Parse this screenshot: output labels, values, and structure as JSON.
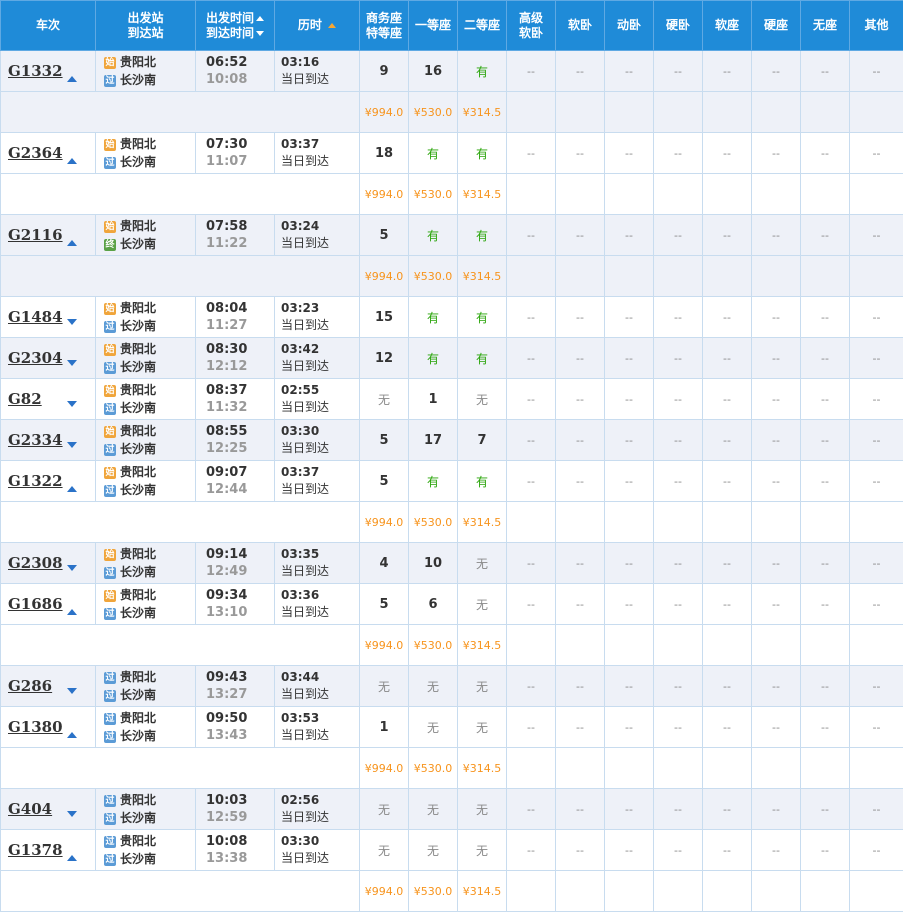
{
  "headers": {
    "train": "车次",
    "dep_station": "出发站",
    "arr_station": "到达站",
    "dep_time": "出发时间",
    "arr_time": "到达时间",
    "duration": "历时",
    "business_1": "商务座",
    "business_2": "特等座",
    "first": "一等座",
    "second": "二等座",
    "hs_1": "高级",
    "hs_2": "软卧",
    "soft_sleeper": "软卧",
    "dyn_sleeper": "动卧",
    "hard_sleeper": "硬卧",
    "soft_seat": "软座",
    "hard_seat": "硬座",
    "no_seat": "无座",
    "other": "其他"
  },
  "labels": {
    "dash": "--"
  },
  "trains": [
    {
      "no": "G1332",
      "toggle": "up",
      "dep_tag": "始",
      "arr_tag": "过",
      "dep_station": "贵阳北",
      "arr_station": "长沙南",
      "dep_time": "06:52",
      "arr_time": "10:08",
      "duration": "03:16",
      "day": "当日到达",
      "business": "9",
      "first": "16",
      "second": "有",
      "price": {
        "business": "¥994.0",
        "first": "¥530.0",
        "second": "¥314.5"
      }
    },
    {
      "no": "G2364",
      "toggle": "up",
      "dep_tag": "始",
      "arr_tag": "过",
      "dep_station": "贵阳北",
      "arr_station": "长沙南",
      "dep_time": "07:30",
      "arr_time": "11:07",
      "duration": "03:37",
      "day": "当日到达",
      "business": "18",
      "first": "有",
      "second": "有",
      "price": {
        "business": "¥994.0",
        "first": "¥530.0",
        "second": "¥314.5"
      }
    },
    {
      "no": "G2116",
      "toggle": "up",
      "dep_tag": "始",
      "arr_tag": "终",
      "dep_station": "贵阳北",
      "arr_station": "长沙南",
      "dep_time": "07:58",
      "arr_time": "11:22",
      "duration": "03:24",
      "day": "当日到达",
      "business": "5",
      "first": "有",
      "second": "有",
      "price": {
        "business": "¥994.0",
        "first": "¥530.0",
        "second": "¥314.5"
      }
    },
    {
      "no": "G1484",
      "toggle": "down",
      "dep_tag": "始",
      "arr_tag": "过",
      "dep_station": "贵阳北",
      "arr_station": "长沙南",
      "dep_time": "08:04",
      "arr_time": "11:27",
      "duration": "03:23",
      "day": "当日到达",
      "business": "15",
      "first": "有",
      "second": "有"
    },
    {
      "no": "G2304",
      "toggle": "down",
      "dep_tag": "始",
      "arr_tag": "过",
      "dep_station": "贵阳北",
      "arr_station": "长沙南",
      "dep_time": "08:30",
      "arr_time": "12:12",
      "duration": "03:42",
      "day": "当日到达",
      "business": "12",
      "first": "有",
      "second": "有"
    },
    {
      "no": "G82",
      "toggle": "down",
      "dep_tag": "始",
      "arr_tag": "过",
      "dep_station": "贵阳北",
      "arr_station": "长沙南",
      "dep_time": "08:37",
      "arr_time": "11:32",
      "duration": "02:55",
      "day": "当日到达",
      "business": "无",
      "first": "1",
      "second": "无"
    },
    {
      "no": "G2334",
      "toggle": "down",
      "dep_tag": "始",
      "arr_tag": "过",
      "dep_station": "贵阳北",
      "arr_station": "长沙南",
      "dep_time": "08:55",
      "arr_time": "12:25",
      "duration": "03:30",
      "day": "当日到达",
      "business": "5",
      "first": "17",
      "second": "7"
    },
    {
      "no": "G1322",
      "toggle": "up",
      "dep_tag": "始",
      "arr_tag": "过",
      "dep_station": "贵阳北",
      "arr_station": "长沙南",
      "dep_time": "09:07",
      "arr_time": "12:44",
      "duration": "03:37",
      "day": "当日到达",
      "business": "5",
      "first": "有",
      "second": "有",
      "price": {
        "business": "¥994.0",
        "first": "¥530.0",
        "second": "¥314.5"
      }
    },
    {
      "no": "G2308",
      "toggle": "down",
      "dep_tag": "始",
      "arr_tag": "过",
      "dep_station": "贵阳北",
      "arr_station": "长沙南",
      "dep_time": "09:14",
      "arr_time": "12:49",
      "duration": "03:35",
      "day": "当日到达",
      "business": "4",
      "first": "10",
      "second": "无"
    },
    {
      "no": "G1686",
      "toggle": "up",
      "dep_tag": "始",
      "arr_tag": "过",
      "dep_station": "贵阳北",
      "arr_station": "长沙南",
      "dep_time": "09:34",
      "arr_time": "13:10",
      "duration": "03:36",
      "day": "当日到达",
      "business": "5",
      "first": "6",
      "second": "无",
      "price": {
        "business": "¥994.0",
        "first": "¥530.0",
        "second": "¥314.5"
      }
    },
    {
      "no": "G286",
      "toggle": "down",
      "dep_tag": "过",
      "arr_tag": "过",
      "dep_station": "贵阳北",
      "arr_station": "长沙南",
      "dep_time": "09:43",
      "arr_time": "13:27",
      "duration": "03:44",
      "day": "当日到达",
      "business": "无",
      "first": "无",
      "second": "无"
    },
    {
      "no": "G1380",
      "toggle": "up",
      "dep_tag": "过",
      "arr_tag": "过",
      "dep_station": "贵阳北",
      "arr_station": "长沙南",
      "dep_time": "09:50",
      "arr_time": "13:43",
      "duration": "03:53",
      "day": "当日到达",
      "business": "1",
      "first": "无",
      "second": "无",
      "price": {
        "business": "¥994.0",
        "first": "¥530.0",
        "second": "¥314.5"
      }
    },
    {
      "no": "G404",
      "toggle": "down",
      "dep_tag": "过",
      "arr_tag": "过",
      "dep_station": "贵阳北",
      "arr_station": "长沙南",
      "dep_time": "10:03",
      "arr_time": "12:59",
      "duration": "02:56",
      "day": "当日到达",
      "business": "无",
      "first": "无",
      "second": "无"
    },
    {
      "no": "G1378",
      "toggle": "up",
      "dep_tag": "过",
      "arr_tag": "过",
      "dep_station": "贵阳北",
      "arr_station": "长沙南",
      "dep_time": "10:08",
      "arr_time": "13:38",
      "duration": "03:30",
      "day": "当日到达",
      "business": "无",
      "first": "无",
      "second": "无",
      "price": {
        "business": "¥994.0",
        "first": "¥530.0",
        "second": "¥314.5"
      }
    }
  ]
}
